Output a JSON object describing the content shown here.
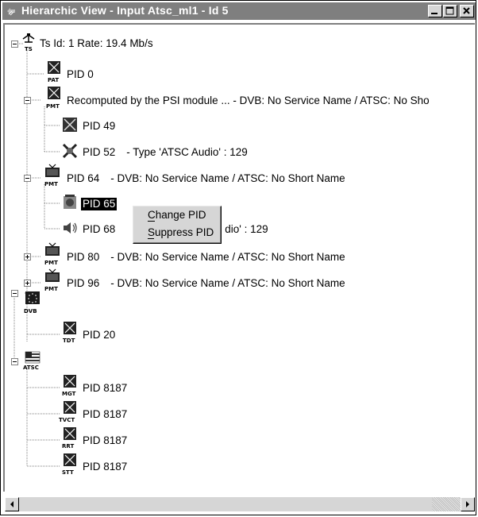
{
  "window": {
    "title": "Hierarchic View - Input Atsc_ml1 - Id 5"
  },
  "tree": {
    "root": {
      "label": "Ts Id: 1 Rate: 19.4 Mb/s",
      "icon_caption": "TS",
      "icon": "ts-network-icon"
    },
    "pat": {
      "label": "PID 0",
      "icon_caption": "PAT",
      "icon": "pat-table-icon"
    },
    "pmt_main": {
      "label": "Recomputed by the PSI module ... - DVB: No Service Name / ATSC: No Sho",
      "icon_caption": "PMT",
      "icon": "pmt-table-icon"
    },
    "pid49": {
      "label": "PID 49",
      "icon": "video-stream-icon"
    },
    "pid52": {
      "label": "PID 52",
      "desc": "- Type 'ATSC Audio' : 129",
      "icon": "audio-stream-icon"
    },
    "pmt64": {
      "label": "PID 64",
      "desc": "- DVB: No Service Name / ATSC: No Short Name",
      "icon_caption": "PMT",
      "icon": "tv-pmt-icon"
    },
    "pid65": {
      "label": "PID 65",
      "icon": "video-stream-icon"
    },
    "pid68": {
      "label": "PID 68",
      "desc": "dio' : 129",
      "icon": "speaker-audio-icon"
    },
    "pmt80": {
      "label": "PID 80",
      "desc": "- DVB: No Service Name / ATSC: No Short Name",
      "icon_caption": "PMT",
      "icon": "tv-pmt-icon"
    },
    "pmt96": {
      "label": "PID 96",
      "desc": "- DVB: No Service Name / ATSC: No Short Name",
      "icon_caption": "PMT",
      "icon": "tv-pmt-icon"
    },
    "dvb": {
      "icon_caption": "DVB",
      "icon": "eu-flag-icon"
    },
    "pid20": {
      "label": "PID 20",
      "icon_caption": "TDT",
      "icon": "tdt-table-icon"
    },
    "atsc": {
      "icon_caption": "ATSC",
      "icon": "us-flag-icon"
    },
    "mgt": {
      "label": "PID 8187",
      "icon_caption": "MGT",
      "icon": "mgt-table-icon"
    },
    "tvct": {
      "label": "PID 8187",
      "icon_caption": "TVCT",
      "icon": "tvct-table-icon"
    },
    "rrt": {
      "label": "PID 8187",
      "icon_caption": "RRT",
      "icon": "rrt-table-icon"
    },
    "stt": {
      "label": "PID 8187",
      "icon_caption": "STT",
      "icon": "stt-table-icon"
    }
  },
  "context_menu": {
    "items": [
      {
        "label": "Change PID",
        "mnemonic": "C"
      },
      {
        "label": "Suppress PID",
        "mnemonic": "S"
      }
    ]
  },
  "colors": {
    "titlebar": "#7f7f7f",
    "selection": "#000000",
    "face": "#d6d6d6"
  }
}
